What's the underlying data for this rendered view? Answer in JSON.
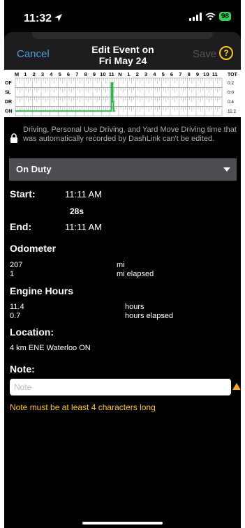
{
  "status_bar": {
    "time": "11:32",
    "battery": "98"
  },
  "header": {
    "cancel_label": "Cancel",
    "title_line1": "Edit Event on",
    "title_line2": "Fri May 24",
    "save_label": "Save",
    "help_label": "?"
  },
  "log_chart": {
    "hour_labels": [
      "M",
      "1",
      "2",
      "3",
      "4",
      "5",
      "6",
      "7",
      "8",
      "9",
      "10",
      "11",
      "N",
      "1",
      "2",
      "3",
      "4",
      "5",
      "6",
      "7",
      "8",
      "9",
      "10",
      "11"
    ],
    "total_header": "TOT",
    "rows": [
      {
        "label": "OF",
        "total": "0:2"
      },
      {
        "label": "SL",
        "total": "0:0"
      },
      {
        "label": "DR",
        "total": "0:4"
      },
      {
        "label": "ON",
        "total": "11:2"
      }
    ],
    "colors": {
      "line": "#2fb84a",
      "grid": "#9a9a9a"
    }
  },
  "notice": {
    "text": "Driving, Personal Use Driving, and Yard Move Driving time that was automatically recorded by DashLink can't be edited.",
    "icon": "lock-icon"
  },
  "duty_status": {
    "selected": "On Duty"
  },
  "times": {
    "start_label": "Start:",
    "start_value": "11:11 AM",
    "duration": "28s",
    "end_label": "End:",
    "end_value": "11:11 AM"
  },
  "odometer": {
    "label": "Odometer",
    "value": "207",
    "unit": "mi",
    "elapsed": "1",
    "elapsed_unit": "mi elapsed"
  },
  "engine_hours": {
    "label": "Engine Hours",
    "value": "11.4",
    "unit": "hours",
    "elapsed": "0.7",
    "elapsed_unit": "hours elapsed"
  },
  "location": {
    "label": "Location:",
    "value": "4 km ENE Waterloo ON"
  },
  "note": {
    "label": "Note:",
    "placeholder": "Note",
    "value": "",
    "error": "Note must be at least 4 characters long"
  }
}
